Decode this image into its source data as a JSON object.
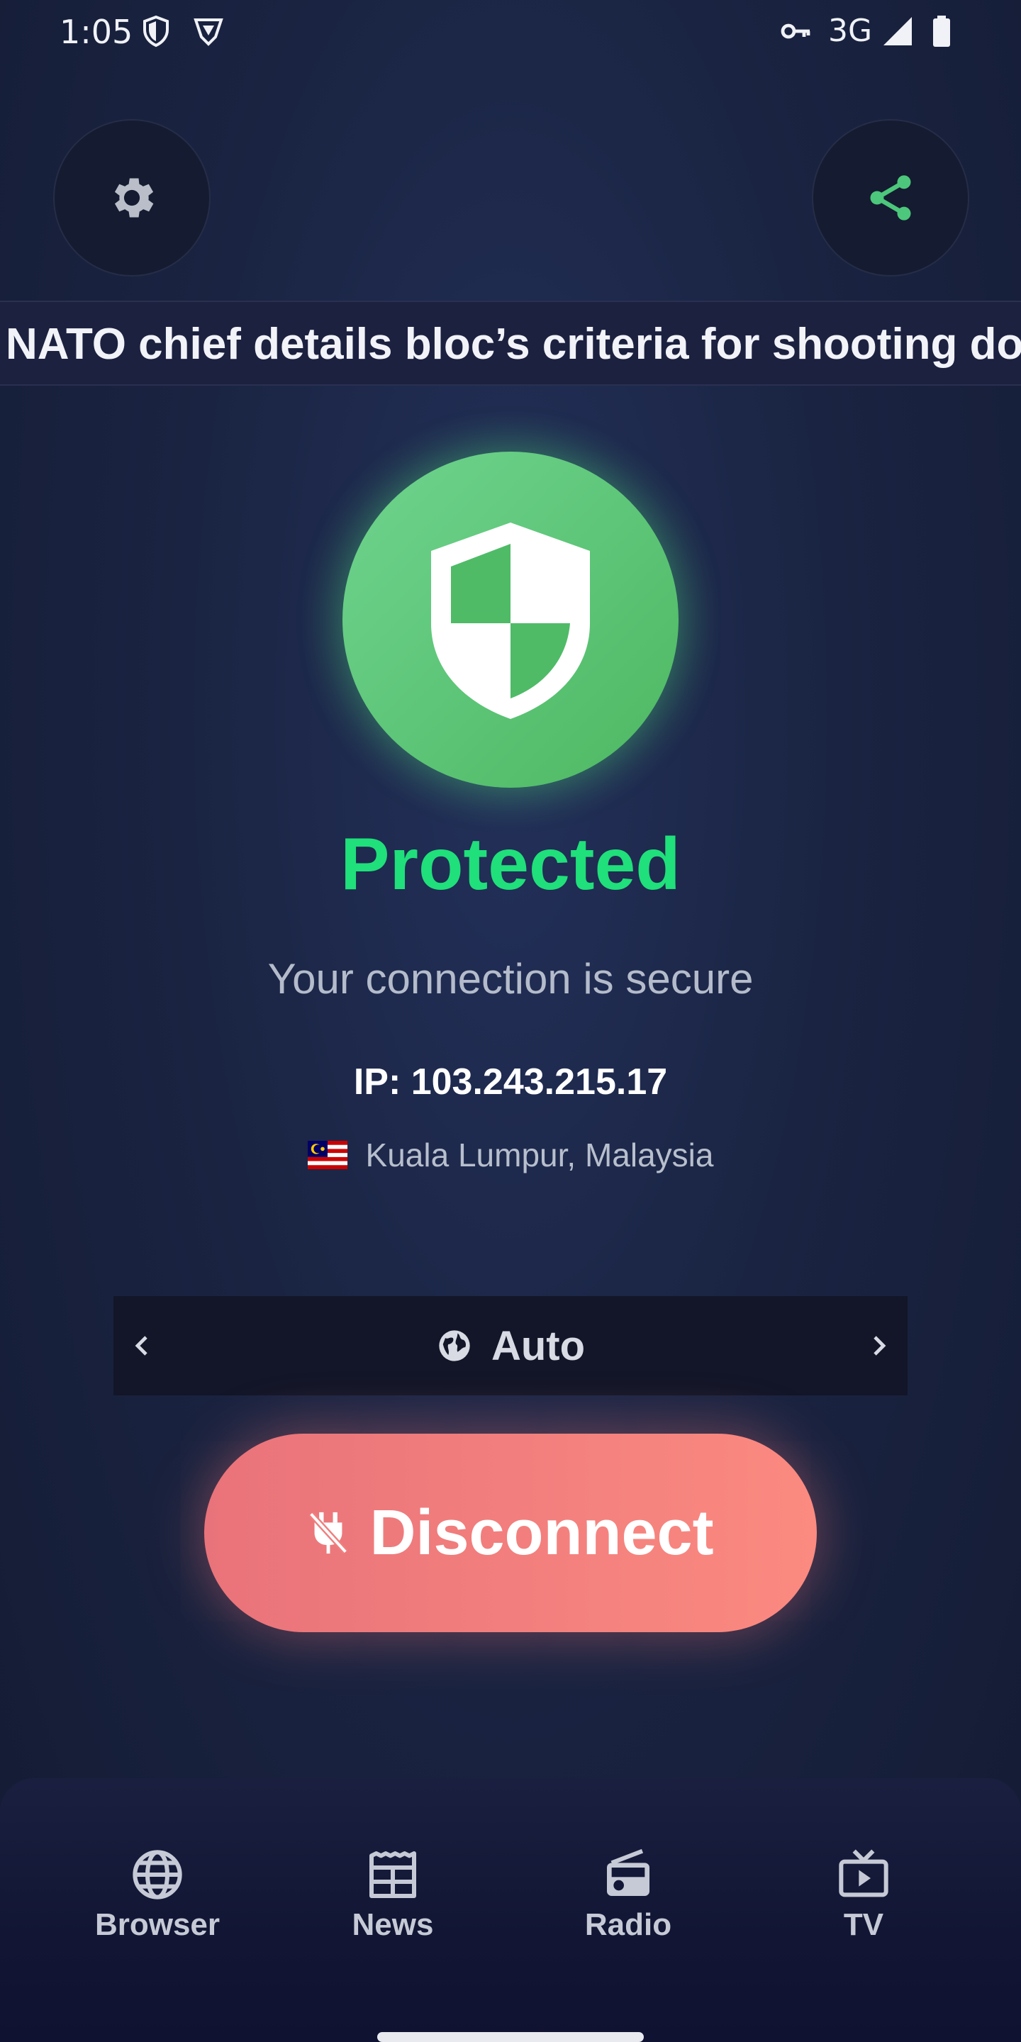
{
  "status_bar": {
    "time": "1:05",
    "network": "3G",
    "icons": [
      "shield-outline-icon",
      "brave-icon",
      "vpn-key-icon",
      "signal-icon",
      "battery-icon"
    ]
  },
  "header": {
    "settings_icon": "gear-icon",
    "share_icon": "share-icon",
    "accent_color": "#4cc77b"
  },
  "ticker": {
    "headline": "NATO chief details bloc’s criteria for shooting do"
  },
  "connection": {
    "status": "Protected",
    "status_color": "#1fe07a",
    "subtitle": "Your connection is secure",
    "ip": "IP: 103.243.215.17",
    "flag": "malaysia-flag-icon",
    "location": "Kuala Lumpur, Malaysia"
  },
  "server_selector": {
    "value": "Auto",
    "icon": "globe-icon"
  },
  "disconnect_button": {
    "label": "Disconnect",
    "icon": "plug-off-icon",
    "color": "#f47f7d"
  },
  "bottom_nav": {
    "items": [
      {
        "label": "Browser",
        "icon": "globe-icon"
      },
      {
        "label": "News",
        "icon": "newspaper-icon"
      },
      {
        "label": "Radio",
        "icon": "radio-icon"
      },
      {
        "label": "TV",
        "icon": "tv-icon"
      }
    ]
  }
}
